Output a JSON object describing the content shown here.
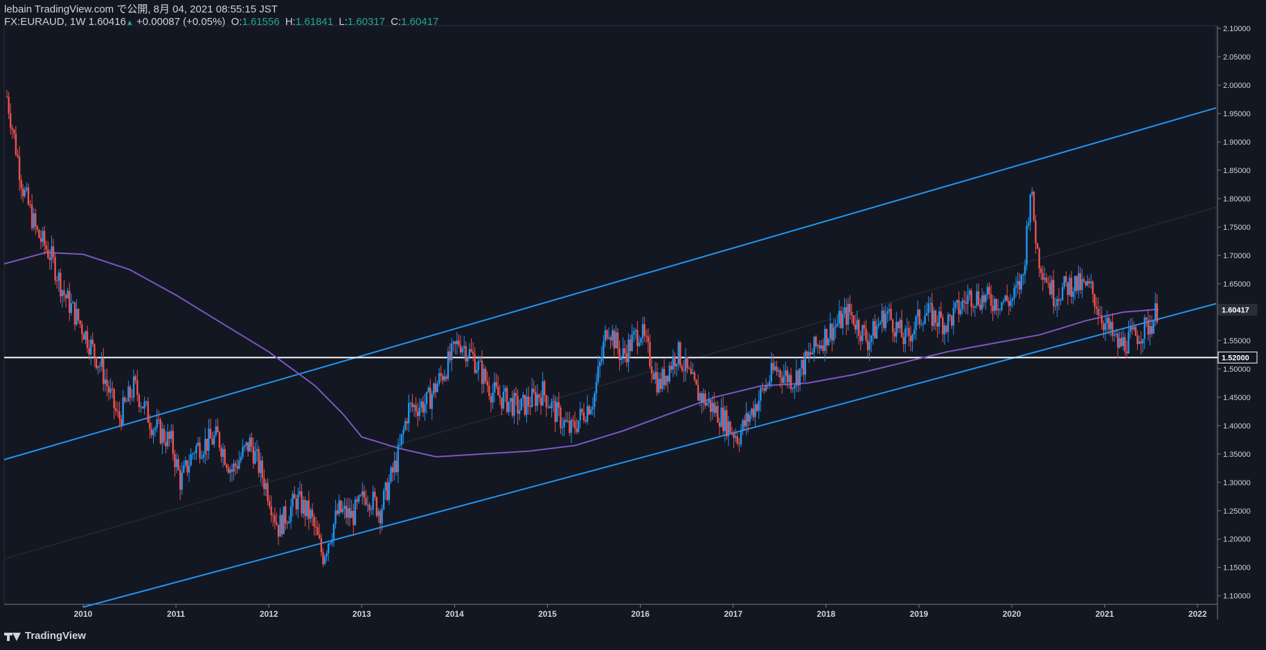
{
  "header": {
    "published": "lebain TradingView.com で公開, 8月 04, 2021 08:55:15 JST",
    "symbol": "FX:EURAUD, 1W",
    "last": "1.60416",
    "change_arrow": "▲",
    "change": "+0.00087 (+0.05%)",
    "o_label": "O:",
    "o": "1.61556",
    "h_label": "H:",
    "h": "1.61841",
    "l_label": "L:",
    "l": "1.60317",
    "c_label": "C:",
    "c": "1.60417"
  },
  "footer": {
    "brand": "TradingView"
  },
  "colors": {
    "background": "#131722",
    "up_candle": "#2196f3",
    "down_candle": "#ef5350",
    "moving_average": "#7e57c2",
    "channel": "#2196f3",
    "horizontal_level": "#ffffff",
    "ohlc_value": "#26a69a"
  },
  "chart_data": {
    "type": "candlestick",
    "symbol": "EURAUD",
    "timeframe": "1W",
    "xlim": [
      2009.15,
      2022.2
    ],
    "ylim": [
      1.085,
      2.105
    ],
    "x_ticks": [
      "2010",
      "2011",
      "2012",
      "2013",
      "2014",
      "2015",
      "2016",
      "2017",
      "2018",
      "2019",
      "2020",
      "2021",
      "2022"
    ],
    "y_ticks": [
      "2.10000",
      "2.05000",
      "2.00000",
      "1.95000",
      "1.90000",
      "1.85000",
      "1.80000",
      "1.75000",
      "1.70000",
      "1.65000",
      "1.60000",
      "1.55000",
      "1.50000",
      "1.45000",
      "1.40000",
      "1.35000",
      "1.30000",
      "1.25000",
      "1.20000",
      "1.15000",
      "1.10000"
    ],
    "price_anchors": [
      [
        2009.18,
        1.98
      ],
      [
        2009.35,
        1.82
      ],
      [
        2009.5,
        1.74
      ],
      [
        2009.65,
        1.7
      ],
      [
        2009.8,
        1.63
      ],
      [
        2010.0,
        1.57
      ],
      [
        2010.2,
        1.5
      ],
      [
        2010.38,
        1.41
      ],
      [
        2010.55,
        1.47
      ],
      [
        2010.75,
        1.4
      ],
      [
        2010.95,
        1.37
      ],
      [
        2011.05,
        1.3
      ],
      [
        2011.2,
        1.36
      ],
      [
        2011.45,
        1.38
      ],
      [
        2011.6,
        1.32
      ],
      [
        2011.8,
        1.37
      ],
      [
        2012.0,
        1.28
      ],
      [
        2012.1,
        1.22
      ],
      [
        2012.3,
        1.27
      ],
      [
        2012.45,
        1.24
      ],
      [
        2012.58,
        1.17
      ],
      [
        2012.75,
        1.25
      ],
      [
        2012.9,
        1.24
      ],
      [
        2013.05,
        1.28
      ],
      [
        2013.2,
        1.25
      ],
      [
        2013.4,
        1.35
      ],
      [
        2013.5,
        1.43
      ],
      [
        2013.7,
        1.44
      ],
      [
        2013.9,
        1.5
      ],
      [
        2014.05,
        1.55
      ],
      [
        2014.2,
        1.52
      ],
      [
        2014.4,
        1.46
      ],
      [
        2014.7,
        1.43
      ],
      [
        2014.95,
        1.46
      ],
      [
        2015.1,
        1.42
      ],
      [
        2015.25,
        1.39
      ],
      [
        2015.5,
        1.45
      ],
      [
        2015.65,
        1.58
      ],
      [
        2015.8,
        1.52
      ],
      [
        2016.0,
        1.57
      ],
      [
        2016.2,
        1.47
      ],
      [
        2016.4,
        1.53
      ],
      [
        2016.6,
        1.46
      ],
      [
        2016.85,
        1.42
      ],
      [
        2017.05,
        1.38
      ],
      [
        2017.25,
        1.44
      ],
      [
        2017.45,
        1.5
      ],
      [
        2017.65,
        1.48
      ],
      [
        2017.85,
        1.53
      ],
      [
        2018.0,
        1.56
      ],
      [
        2018.25,
        1.6
      ],
      [
        2018.45,
        1.55
      ],
      [
        2018.65,
        1.6
      ],
      [
        2018.85,
        1.55
      ],
      [
        2019.05,
        1.6
      ],
      [
        2019.3,
        1.58
      ],
      [
        2019.55,
        1.63
      ],
      [
        2019.8,
        1.62
      ],
      [
        2020.0,
        1.62
      ],
      [
        2020.12,
        1.66
      ],
      [
        2020.2,
        1.82
      ],
      [
        2020.28,
        1.7
      ],
      [
        2020.45,
        1.63
      ],
      [
        2020.65,
        1.65
      ],
      [
        2020.85,
        1.64
      ],
      [
        2021.0,
        1.58
      ],
      [
        2021.15,
        1.54
      ],
      [
        2021.35,
        1.56
      ],
      [
        2021.5,
        1.58
      ],
      [
        2021.58,
        1.61
      ]
    ],
    "moving_average": [
      [
        2009.15,
        1.685
      ],
      [
        2009.6,
        1.705
      ],
      [
        2010.0,
        1.702
      ],
      [
        2010.5,
        1.675
      ],
      [
        2011.0,
        1.63
      ],
      [
        2011.5,
        1.58
      ],
      [
        2012.0,
        1.53
      ],
      [
        2012.5,
        1.47
      ],
      [
        2012.8,
        1.42
      ],
      [
        2013.0,
        1.38
      ],
      [
        2013.4,
        1.36
      ],
      [
        2013.8,
        1.345
      ],
      [
        2014.3,
        1.35
      ],
      [
        2014.8,
        1.355
      ],
      [
        2015.3,
        1.365
      ],
      [
        2015.8,
        1.39
      ],
      [
        2016.3,
        1.42
      ],
      [
        2016.8,
        1.45
      ],
      [
        2017.3,
        1.47
      ],
      [
        2017.8,
        1.475
      ],
      [
        2018.3,
        1.49
      ],
      [
        2018.8,
        1.51
      ],
      [
        2019.3,
        1.53
      ],
      [
        2019.8,
        1.545
      ],
      [
        2020.3,
        1.56
      ],
      [
        2020.8,
        1.585
      ],
      [
        2021.2,
        1.6
      ],
      [
        2021.58,
        1.605
      ]
    ],
    "channel_upper": [
      [
        2009.15,
        1.34
      ],
      [
        2022.2,
        1.96
      ]
    ],
    "channel_lower": [
      [
        2010.0,
        1.08
      ],
      [
        2022.2,
        1.615
      ]
    ],
    "channel_mid": [
      [
        2009.15,
        1.165
      ],
      [
        2022.2,
        1.785
      ]
    ],
    "horizontal_level": {
      "price": 1.52,
      "label": "1.52000"
    },
    "last_price": {
      "price": 1.60417,
      "label": "1.60417"
    }
  }
}
